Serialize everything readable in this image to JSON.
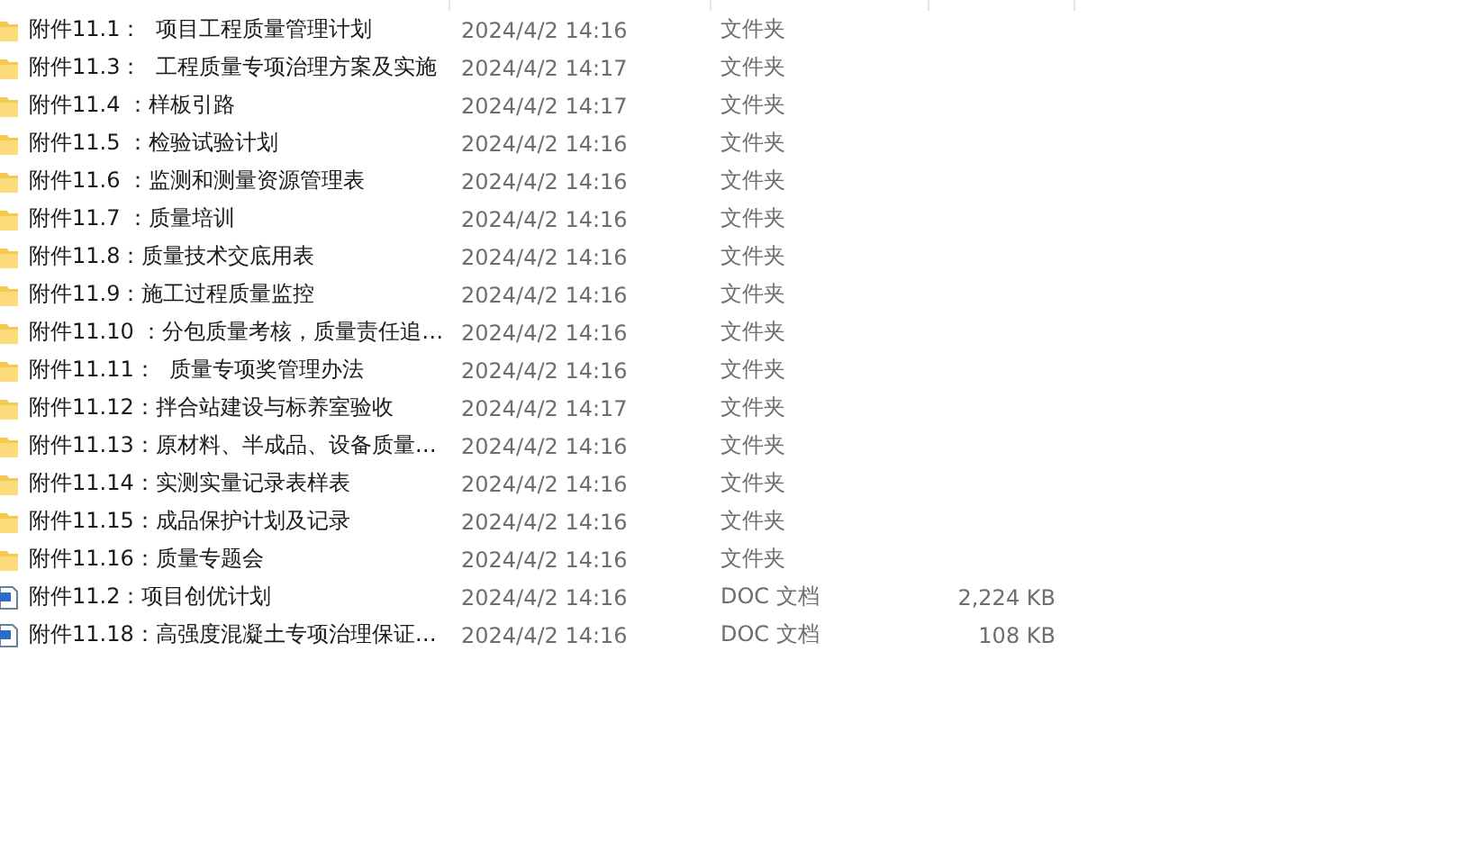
{
  "files": [
    {
      "kind": "folder",
      "name": "附件11.1：  项目工程质量管理计划",
      "modified": "2024/4/2 14:16",
      "type": "文件夹"
    },
    {
      "kind": "folder",
      "name": "附件11.3：  工程质量专项治理方案及实施",
      "modified": "2024/4/2 14:17",
      "type": "文件夹"
    },
    {
      "kind": "folder",
      "name": "附件11.4 ：样板引路",
      "modified": "2024/4/2 14:17",
      "type": "文件夹"
    },
    {
      "kind": "folder",
      "name": "附件11.5 ：检验试验计划",
      "modified": "2024/4/2 14:16",
      "type": "文件夹"
    },
    {
      "kind": "folder",
      "name": "附件11.6 ：监测和测量资源管理表",
      "modified": "2024/4/2 14:16",
      "type": "文件夹"
    },
    {
      "kind": "folder",
      "name": "附件11.7 ：质量培训",
      "modified": "2024/4/2 14:16",
      "type": "文件夹"
    },
    {
      "kind": "folder",
      "name": "附件11.8：质量技术交底用表",
      "modified": "2024/4/2 14:16",
      "type": "文件夹"
    },
    {
      "kind": "folder",
      "name": "附件11.9：施工过程质量监控",
      "modified": "2024/4/2 14:16",
      "type": "文件夹"
    },
    {
      "kind": "folder",
      "name": "附件11.10 ：分包质量考核，质量责任追…",
      "modified": "2024/4/2 14:16",
      "type": "文件夹"
    },
    {
      "kind": "folder",
      "name": "附件11.11：  质量专项奖管理办法",
      "modified": "2024/4/2 14:16",
      "type": "文件夹"
    },
    {
      "kind": "folder",
      "name": "附件11.12：拌合站建设与标养室验收",
      "modified": "2024/4/2 14:17",
      "type": "文件夹"
    },
    {
      "kind": "folder",
      "name": "附件11.13：原材料、半成品、设备质量…",
      "modified": "2024/4/2 14:16",
      "type": "文件夹"
    },
    {
      "kind": "folder",
      "name": "附件11.14：实测实量记录表样表",
      "modified": "2024/4/2 14:16",
      "type": "文件夹"
    },
    {
      "kind": "folder",
      "name": "附件11.15：成品保护计划及记录",
      "modified": "2024/4/2 14:16",
      "type": "文件夹"
    },
    {
      "kind": "folder",
      "name": "附件11.16：质量专题会",
      "modified": "2024/4/2 14:16",
      "type": "文件夹"
    },
    {
      "kind": "doc",
      "name": "附件11.2：项目创优计划",
      "modified": "2024/4/2 14:16",
      "type": "DOC 文档",
      "size": "2,224 KB"
    },
    {
      "kind": "doc",
      "name": "附件11.18：高强度混凝土专项治理保证…",
      "modified": "2024/4/2 14:16",
      "type": "DOC 文档",
      "size": "108 KB"
    }
  ]
}
